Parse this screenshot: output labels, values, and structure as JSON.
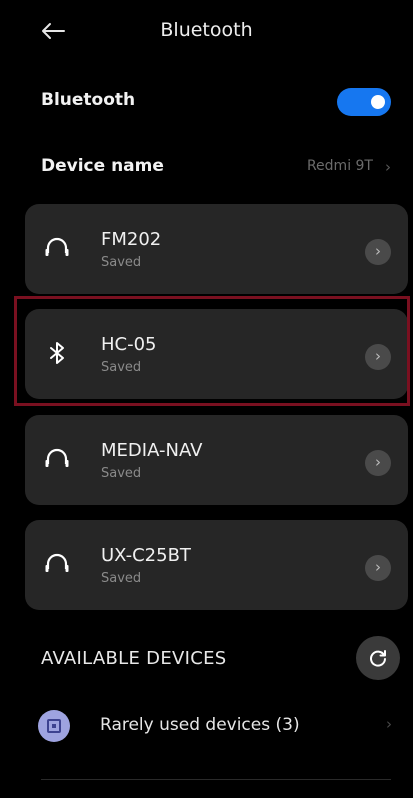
{
  "header": {
    "title": "Bluetooth",
    "back_icon": "back-arrow-icon"
  },
  "bluetooth_toggle": {
    "label": "Bluetooth",
    "enabled": true,
    "color": "#1677f0"
  },
  "device_name": {
    "label": "Device name",
    "value": "Redmi 9T"
  },
  "saved_devices": [
    {
      "name": "FM202",
      "status": "Saved",
      "icon": "headphones-icon"
    },
    {
      "name": "HC-05",
      "status": "Saved",
      "icon": "bluetooth-icon",
      "highlighted": true
    },
    {
      "name": "MEDIA-NAV",
      "status": "Saved",
      "icon": "headphones-icon"
    },
    {
      "name": "UX-C25BT",
      "status": "Saved",
      "icon": "headphones-icon"
    }
  ],
  "available": {
    "heading": "AVAILABLE DEVICES",
    "refresh_icon": "refresh-icon",
    "rarely_used_label": "Rarely used devices (3)"
  },
  "colors": {
    "background": "#000000",
    "card": "#262626",
    "highlight_border": "#7a1020"
  }
}
